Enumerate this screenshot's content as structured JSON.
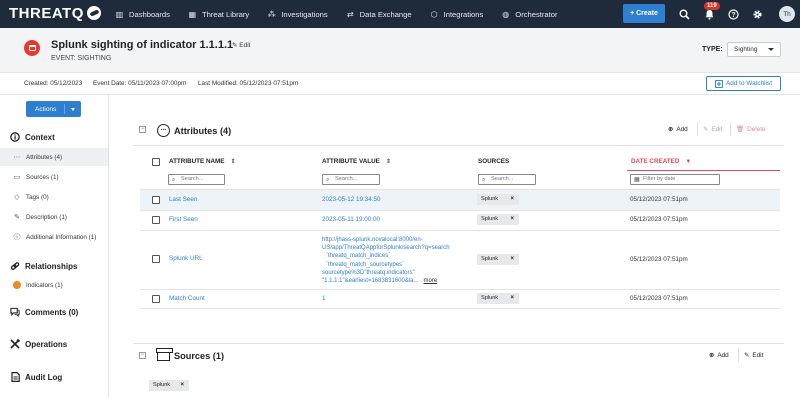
{
  "nav": {
    "logo": "THREATQ",
    "items": [
      {
        "icon": "bar-chart-icon",
        "glyph": "▥",
        "label": "Dashboards"
      },
      {
        "icon": "library-icon",
        "glyph": "▦",
        "label": "Threat Library"
      },
      {
        "icon": "network-icon",
        "glyph": "⁂",
        "label": "Investigations"
      },
      {
        "icon": "exchange-icon",
        "glyph": "⇄",
        "label": "Data Exchange"
      },
      {
        "icon": "integrations-icon",
        "glyph": "⬡",
        "label": "Integrations"
      },
      {
        "icon": "orchestrator-icon",
        "glyph": "◍",
        "label": "Orchestrator"
      }
    ],
    "create_label": "+ Create",
    "notification_count": "119",
    "avatar_initials": "Th"
  },
  "header": {
    "title": "Splunk sighting of indicator 1.1.1.1",
    "edit_label": "Edit",
    "subtitle": "EVENT: SIGHTING",
    "type_label": "TYPE:",
    "type_value": "Sighting",
    "event_color": "#e5392e"
  },
  "meta": {
    "created": "Created: 05/12/2023",
    "event_date": "Event Date: 05/11/2023 07:00pm",
    "last_modified": "Last Modified: 05/12/2023 07:51pm",
    "watchlist_label": "Add to Watchlist"
  },
  "sidebar": {
    "actions_label": "Actions",
    "context_label": "Context",
    "context_items": [
      {
        "label": "Attributes (4)",
        "glyph": "⋯",
        "icon": "attributes-icon"
      },
      {
        "label": "Sources (1)",
        "glyph": "▭",
        "icon": "sources-icon"
      },
      {
        "label": "Tags (0)",
        "glyph": "◇",
        "icon": "tag-icon"
      },
      {
        "label": "Description (1)",
        "glyph": "✎",
        "icon": "description-icon"
      },
      {
        "label": "Additional Information (1)",
        "glyph": "ⓘ",
        "icon": "info-icon"
      }
    ],
    "relationships_label": "Relationships",
    "relationship_items": [
      {
        "label": "Indicators (1)"
      }
    ],
    "comments_label": "Comments (0)",
    "operations_label": "Operations",
    "audit_label": "Audit Log"
  },
  "attributes": {
    "title": "Attributes (4)",
    "add_label": "Add",
    "edit_label": "Edit",
    "delete_label": "Delete",
    "columns": {
      "name": "ATTRIBUTE NAME",
      "value": "ATTRIBUTE VALUE",
      "sources": "SOURCES",
      "date": "DATE CREATED"
    },
    "search_placeholder": "Search...",
    "date_placeholder": "Filter by date",
    "rows": [
      {
        "name": "Last Seen",
        "value": "2023-05-12 19:34:50",
        "source": "Splunk",
        "date": "05/12/2023 07:51pm"
      },
      {
        "name": "First Seen",
        "value": "2023-05-11 19:00:00",
        "source": "Splunk",
        "date": "05/12/2023 07:51pm"
      },
      {
        "name": "Splunk URL",
        "value_lines": [
          "http://jhass-splunk.novalocal:8000/en-",
          "US/app/ThreatQAppforSplunk/search?q=search",
          "`threatq_match_indices`",
          "`threatq_match_sourcetypes`",
          "sourcetype%3D\"threatq:indicators\"",
          "\"1.1.1.1\"&earliest=1683831600&la..."
        ],
        "more_label": "more",
        "source": "Splunk",
        "date": "05/12/2023 07:51pm"
      },
      {
        "name": "Match Count",
        "value": "1",
        "source": "Splunk",
        "date": "05/12/2023 07:51pm"
      }
    ]
  },
  "sources": {
    "title": "Sources (1)",
    "add_label": "Add",
    "edit_label": "Edit",
    "chip": "Splunk"
  }
}
